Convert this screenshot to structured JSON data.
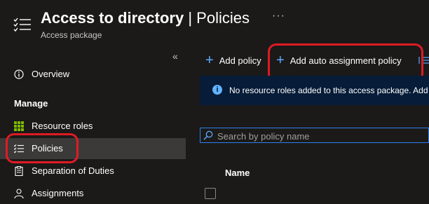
{
  "header": {
    "title_main": "Access to directory",
    "title_separator": " | ",
    "title_section": "Policies",
    "subtitle": "Access package",
    "more_label": "···",
    "page_icon": "list-icon"
  },
  "sidebar": {
    "collapse_label": "«",
    "items": [
      {
        "label": "Overview",
        "icon": "info-icon"
      },
      {
        "label": "Resource roles",
        "icon": "grid-icon"
      },
      {
        "label": "Policies",
        "icon": "list-icon"
      },
      {
        "label": "Separation of Duties",
        "icon": "clipboard-icon"
      },
      {
        "label": "Assignments",
        "icon": "people-icon"
      }
    ],
    "section_label": "Manage",
    "selected": "Policies"
  },
  "toolbar": {
    "add_policy_label": "Add policy",
    "add_auto_assignment_label": "Add auto assignment policy"
  },
  "info_bar": {
    "message": "No resource roles added to this access package. Add r"
  },
  "search": {
    "placeholder": "Search by policy name",
    "value": ""
  },
  "table": {
    "columns": [
      "Name"
    ]
  },
  "colors": {
    "background": "#1b1a19",
    "accent_blue": "#5ea9ff",
    "info_bg": "#061c38",
    "highlight_red": "#e01b24",
    "selected_bg": "#3b3a39"
  }
}
